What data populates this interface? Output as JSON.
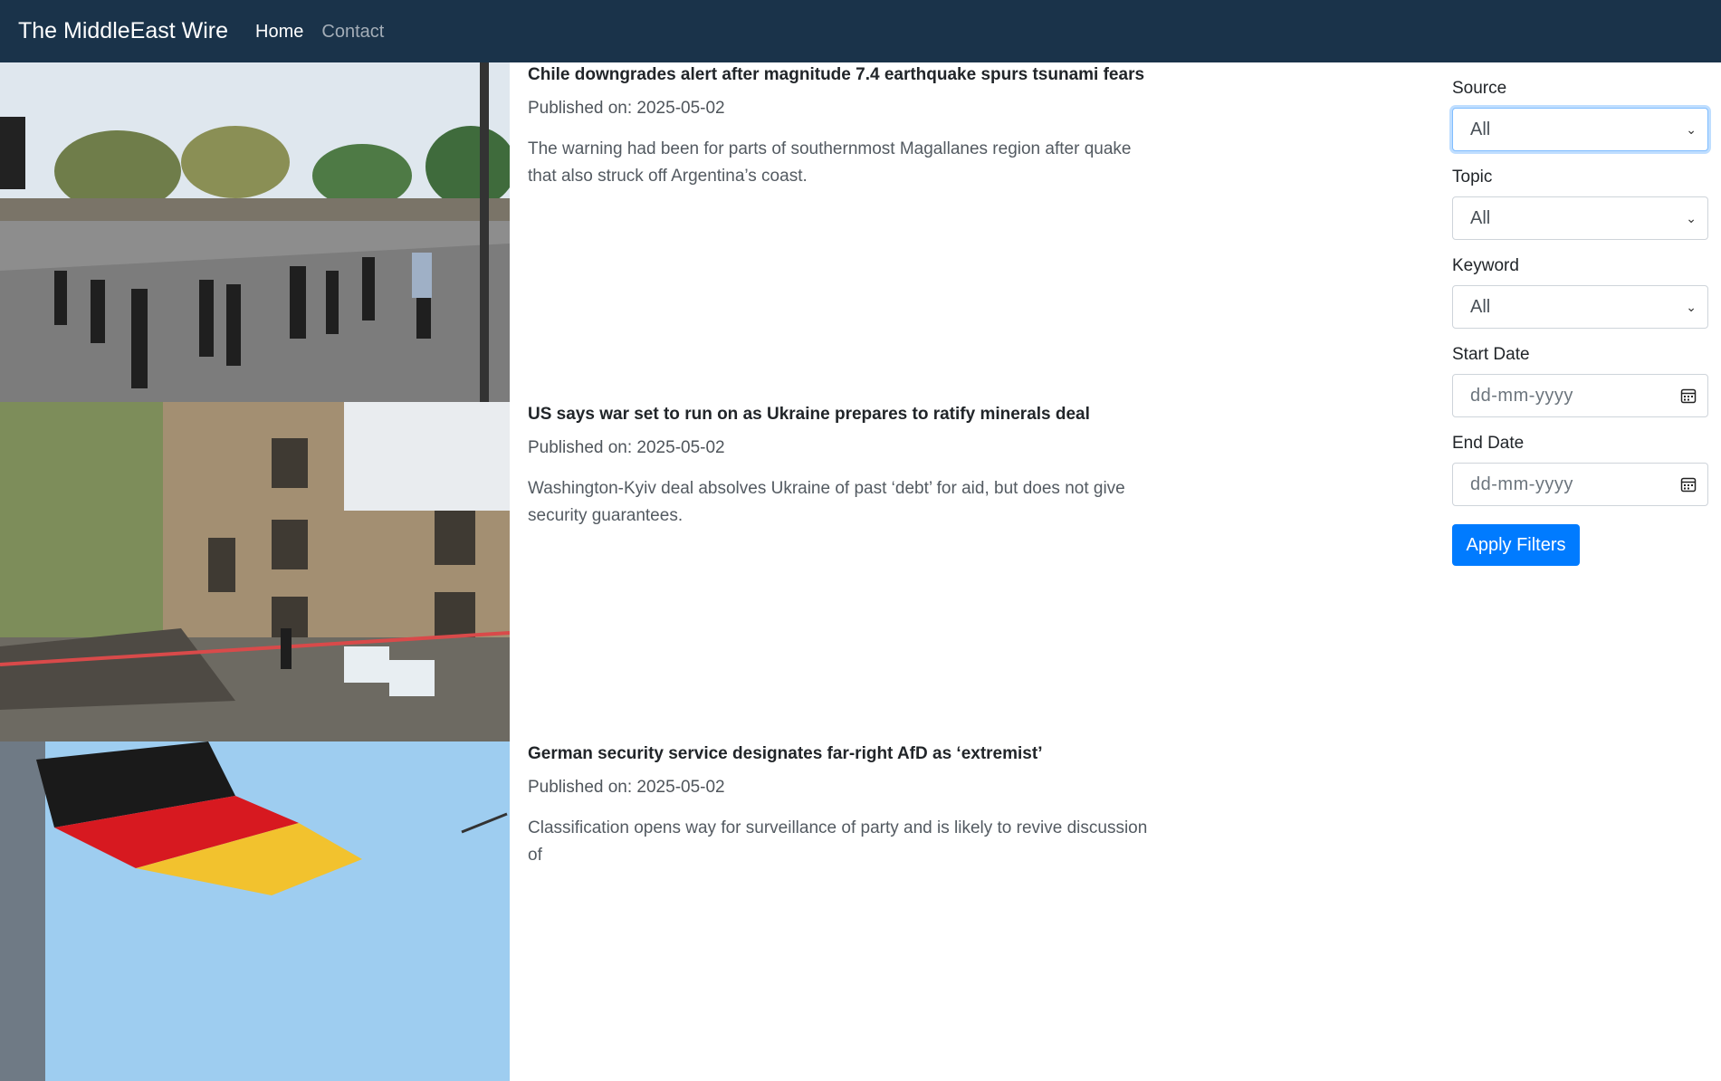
{
  "navbar": {
    "brand": "The MiddleEast Wire",
    "links": [
      {
        "label": "Home",
        "active": true
      },
      {
        "label": "Contact",
        "active": false
      }
    ]
  },
  "articles": [
    {
      "title": "Chile downgrades alert after magnitude 7.4 earthquake spurs tsunami fears",
      "published": "Published on: 2025-05-02",
      "summary": "The warning had been for parts of southernmost Magallanes region after quake that also struck off Argentina’s coast."
    },
    {
      "title": "US says war set to run on as Ukraine prepares to ratify minerals deal",
      "published": "Published on: 2025-05-02",
      "summary": "Washington-Kyiv deal absolves Ukraine of past ‘debt’ for aid, but does not give security guarantees."
    },
    {
      "title": "German security service designates far-right AfD as ‘extremist’",
      "published": "Published on: 2025-05-02",
      "summary": "Classification opens way for surveillance of party and is likely to revive discussion of"
    }
  ],
  "filters": {
    "source": {
      "label": "Source",
      "value": "All"
    },
    "topic": {
      "label": "Topic",
      "value": "All"
    },
    "keyword": {
      "label": "Keyword",
      "value": "All"
    },
    "start_date": {
      "label": "Start Date",
      "placeholder": "dd-mm-yyyy"
    },
    "end_date": {
      "label": "End Date",
      "placeholder": "dd-mm-yyyy"
    },
    "apply_label": "Apply Filters"
  },
  "colors": {
    "navbar_bg": "#1a334a",
    "primary": "#007bff"
  }
}
